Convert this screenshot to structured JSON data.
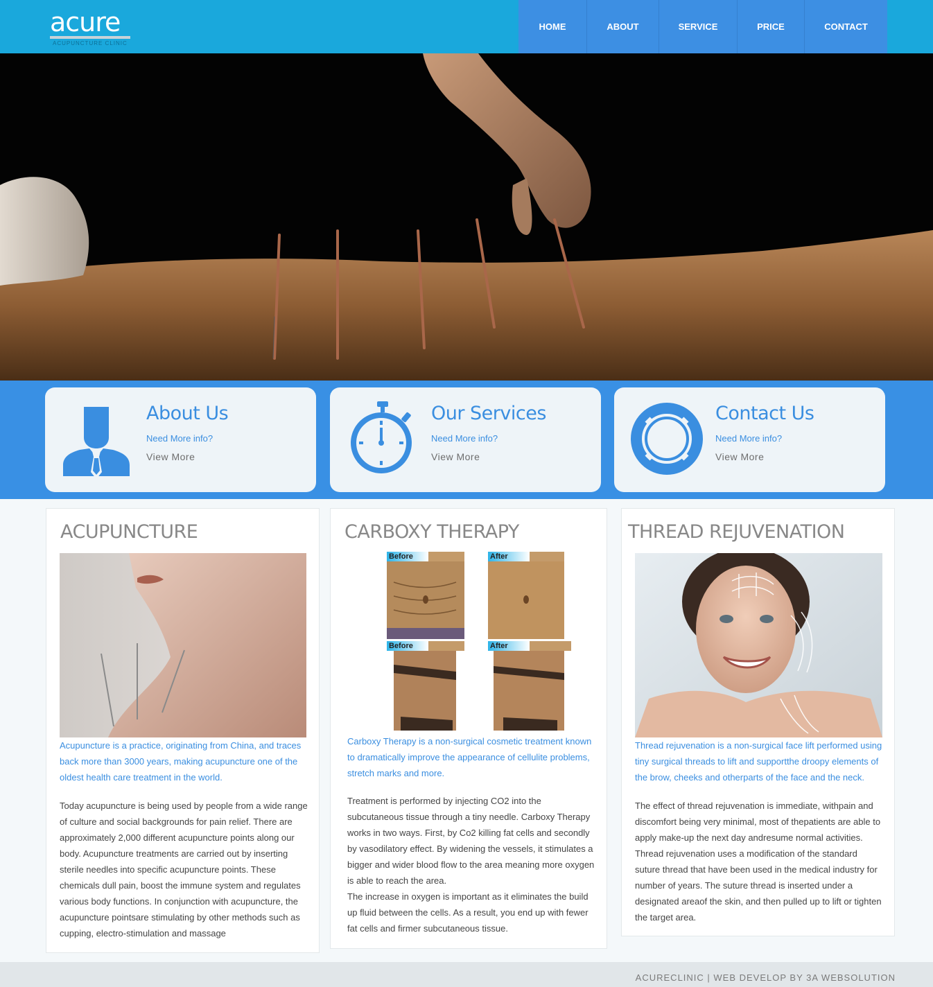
{
  "header": {
    "logo_word": "acure",
    "logo_sub": "ACUPUNCTURE CLINIC",
    "nav": [
      {
        "label": "HOME"
      },
      {
        "label": "ABOUT"
      },
      {
        "label": "SERVICE"
      },
      {
        "label": "PRICE"
      },
      {
        "label": "CONTACT"
      }
    ]
  },
  "colors": {
    "header_bg": "#1aa8dc",
    "nav_bg": "#3d8fe3",
    "band_bg": "#3990e4",
    "accent_text": "#3a8ee0"
  },
  "features": [
    {
      "icon": "user-icon",
      "title": "About Us",
      "sub": "Need More info?",
      "more": "View More"
    },
    {
      "icon": "stopwatch-icon",
      "title": "Our Services",
      "sub": "Need More info?",
      "more": "View More"
    },
    {
      "icon": "lifebuoy-icon",
      "title": "Contact Us",
      "sub": "Need More info?",
      "more": "View More"
    }
  ],
  "sections": [
    {
      "title": "ACUPUNCTURE",
      "lead": "Acupuncture is a practice, originating from China, and traces back more than 3000 years, making acupuncture one of the oldest health care treatment in the world.",
      "body": "Today acupuncture is being used by people from a wide range of culture and social backgrounds for pain relief. There are approximately 2,000 different acupuncture points along our body. Acupuncture treatments are carried out by inserting sterile needles into specific acupuncture points. These chemicals dull pain, boost the immune system and regulates various body functions. In conjunction with acupuncture, the acupuncture pointsare stimulating by other methods such as cupping, electro-stimulation and massage"
    },
    {
      "title": "CARBOXY THERAPY",
      "image_labels": [
        "Before",
        "After",
        "Before",
        "After"
      ],
      "lead": "Carboxy Therapy is a non-surgical cosmetic treatment known to dramatically improve the appearance of cellulite problems, stretch marks and more.",
      "body": "Treatment is performed by injecting CO2 into the subcutaneous tissue through a tiny needle. Carboxy Therapy works in two ways. First, by Co2 killing fat cells and secondly by vasodilatory effect. By widening the vessels, it stimulates a bigger and wider blood flow to the area meaning more oxygen is able to reach the area.",
      "body2": "The increase in oxygen is important as it eliminates the build up fluid between the cells. As a result, you end up with fewer fat cells and firmer subcutaneous tissue."
    },
    {
      "title": "THREAD REJUVENATION",
      "lead": "Thread rejuvenation is a non-surgical face lift performed using tiny surgical threads to lift and supportthe droopy elements of the brow, cheeks and otherparts of the face and the neck.",
      "body": "The effect of thread rejuvenation is immediate, withpain and discomfort being very minimal, most of thepatients are able to apply make-up the next day andresume normal activities. Thread rejuvenation uses a modification of the standard suture thread that have been used in the medical industry for number of years. The suture thread is inserted under a designated areaof the skin, and then pulled up to lift or tighten the target area."
    }
  ],
  "footer": {
    "text": "ACURECLINIC | WEB DEVELOP BY 3A WEBSOLUTION"
  }
}
